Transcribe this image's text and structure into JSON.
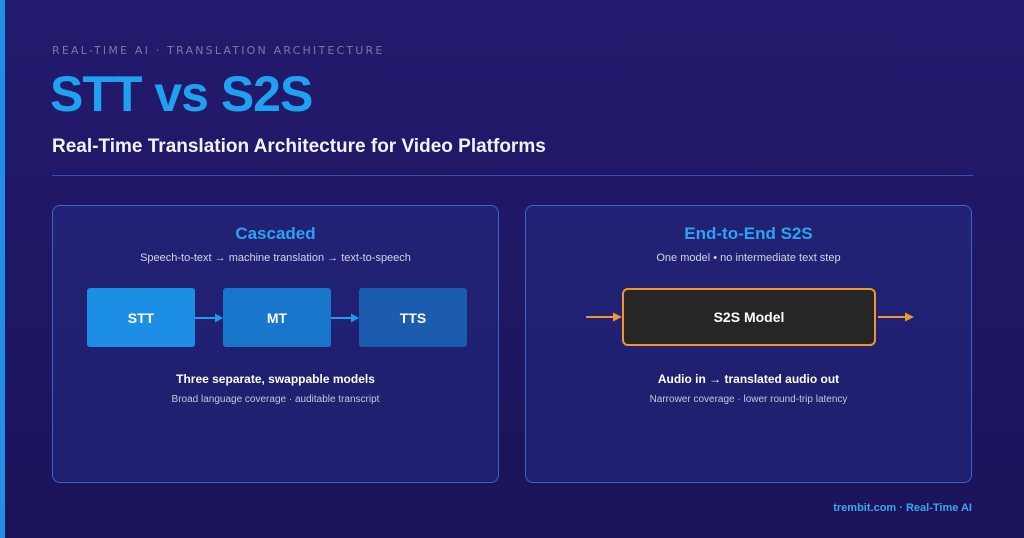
{
  "header": {
    "eyebrow": "REAL-TIME AI · TRANSLATION ARCHITECTURE",
    "title": "STT vs S2S",
    "subtitle": "Real-Time Translation Architecture for Video Platforms"
  },
  "panels": {
    "cascaded": {
      "title": "Cascaded",
      "description": "Speech-to-text → machine translation → text-to-speech",
      "stages": [
        "STT",
        "MT",
        "TTS"
      ],
      "summary": "Three separate, swappable models",
      "note": "Broad language coverage · auditable transcript"
    },
    "end_to_end": {
      "title": "End-to-End S2S",
      "description": "One model • no intermediate text step",
      "model_label": "S2S Model",
      "summary": "Audio in → translated audio out",
      "note": "Narrower coverage · lower round-trip latency"
    }
  },
  "footer": {
    "text": "trembit.com · Real-Time AI"
  },
  "colors": {
    "accent_blue": "#1fa0f0",
    "stage_stt": "#1c8ee4",
    "stage_mt": "#1876cb",
    "stage_tts": "#1c5cae",
    "arrow_blue": "#1e9cf0",
    "arrow_orange": "#f0962e",
    "model_border": "#f0962e"
  }
}
